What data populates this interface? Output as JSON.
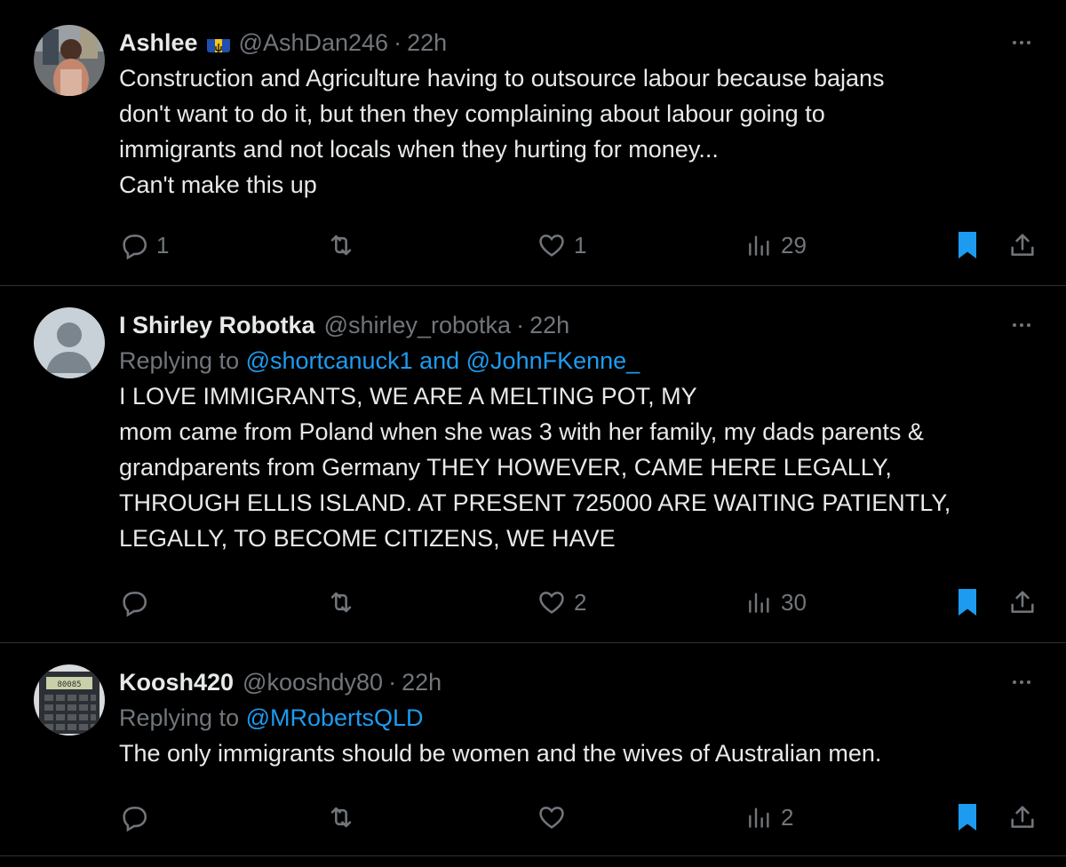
{
  "colors": {
    "background": "#000000",
    "text": "#e7e9ea",
    "muted": "#71767b",
    "link": "#1d9bf0",
    "bookmark_active": "#1d9bf0",
    "divider": "#2f3336"
  },
  "tweets": [
    {
      "name": "Ashlee",
      "flag_icon": "barbados-flag-icon",
      "handle": "@AshDan246",
      "separator": "·",
      "time": "22h",
      "body_lines": [
        "Construction and Agriculture having to outsource labour because bajans",
        "don't want to do it, but then they complaining about labour going to",
        "immigrants and not locals when they hurting for money...",
        "Can't make this up"
      ],
      "replies": "1",
      "likes": "1",
      "views": "29",
      "bookmarked": true
    },
    {
      "name": "I Shirley Robotka",
      "handle": "@shirley_robotka",
      "separator": "·",
      "time": "22h",
      "replying_prefix": "Replying to ",
      "replying_to": "@shortcanuck1 and @JohnFKenne_",
      "body_lines": [
        "I LOVE IMMIGRANTS, WE ARE A MELTING POT, MY",
        "mom came from Poland when she was 3 with her family, my dads parents &",
        "grandparents from Germany  THEY HOWEVER,  CAME HERE LEGALLY,",
        "THROUGH ELLIS ISLAND. AT PRESENT 725000 ARE WAITING PATIENTLY,",
        "LEGALLY, TO BECOME CITIZENS,  WE HAVE"
      ],
      "likes": "2",
      "views": "30",
      "bookmarked": true
    },
    {
      "name": "Koosh420",
      "handle": "@kooshdy80",
      "separator": "·",
      "time": "22h",
      "replying_prefix": "Replying to ",
      "replying_to": "@MRobertsQLD",
      "body_lines": [
        "The only immigrants should be women and the wives of Australian men."
      ],
      "views": "2",
      "bookmarked": true,
      "calculator_display": "80085"
    }
  ]
}
